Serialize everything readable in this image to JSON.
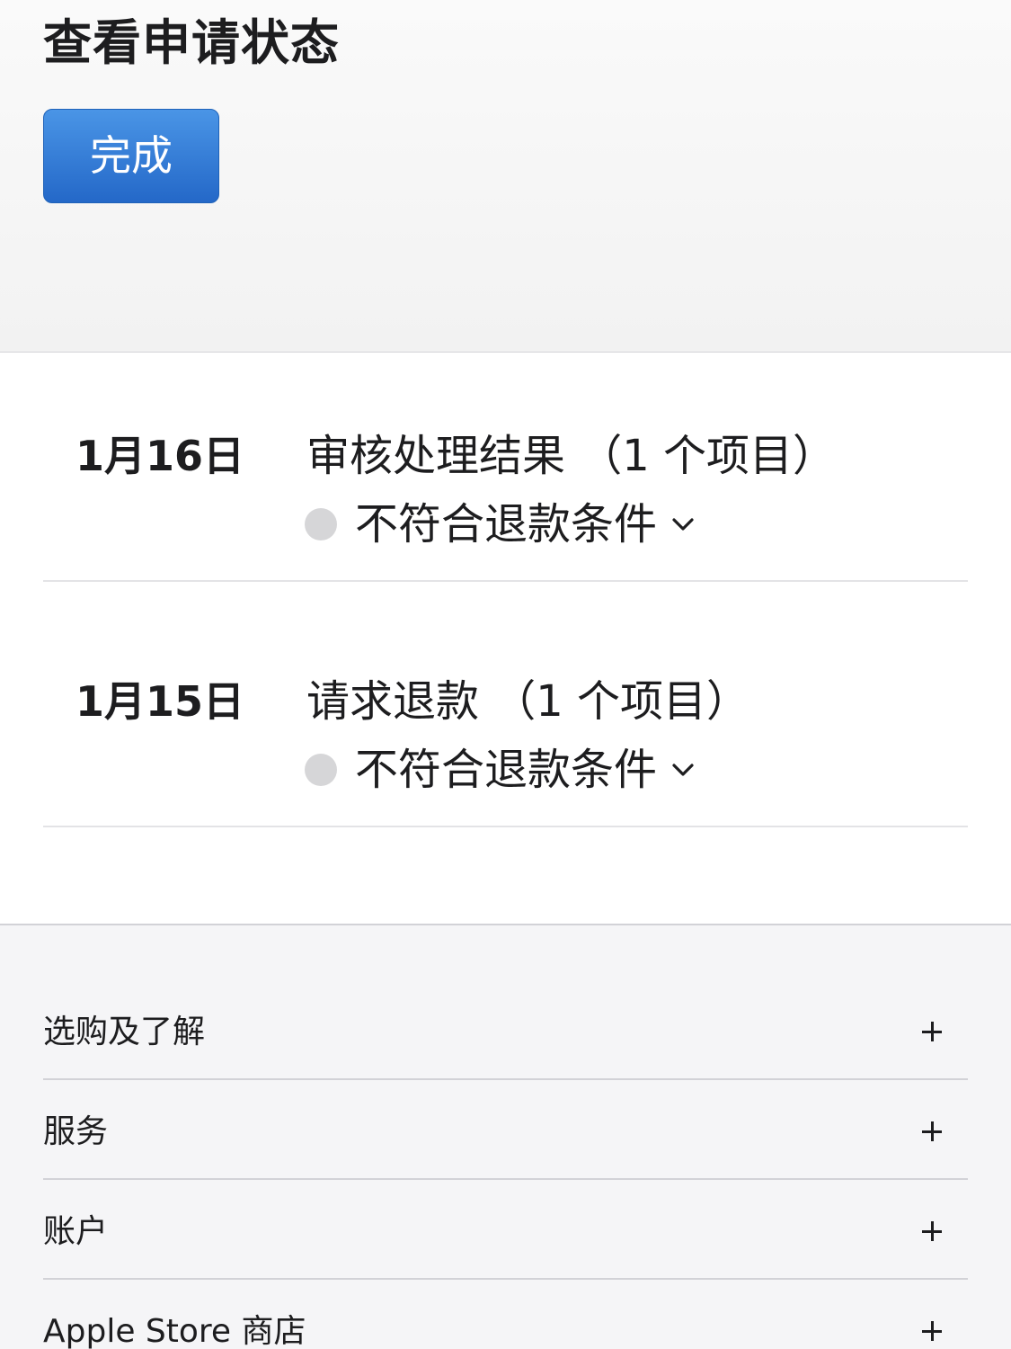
{
  "header": {
    "title": "查看申请状态",
    "done_label": "完成"
  },
  "colors": {
    "accent": "#2f78d8",
    "status_dot": "#d6d6d8",
    "footer_bg": "#f5f5f7"
  },
  "status_rows": [
    {
      "date": "1月16日",
      "title": "审核处理结果 （1 个项目）",
      "status": "不符合退款条件",
      "icon": "chevron-down-icon"
    },
    {
      "date": "1月15日",
      "title": "请求退款 （1 个项目）",
      "status": "不符合退款条件",
      "icon": "chevron-down-icon"
    }
  ],
  "footer": {
    "items": [
      {
        "label": "选购及了解",
        "icon": "plus-icon"
      },
      {
        "label": "服务",
        "icon": "plus-icon"
      },
      {
        "label": "账户",
        "icon": "plus-icon"
      },
      {
        "label": "Apple Store 商店",
        "icon": "plus-icon"
      }
    ]
  }
}
